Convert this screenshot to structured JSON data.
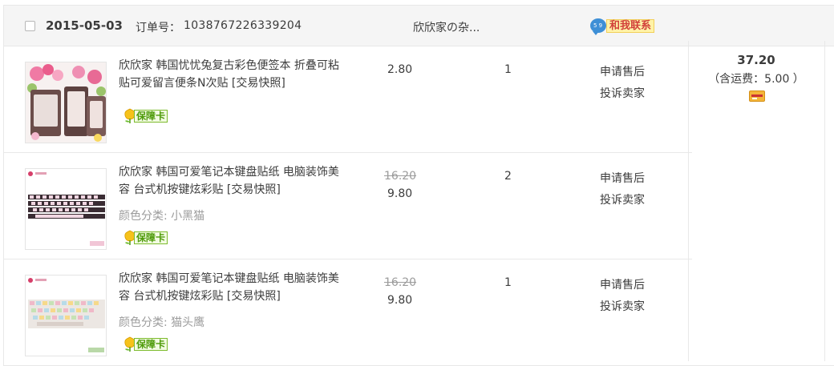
{
  "order": {
    "date": "2015-05-03",
    "order_no_label": "订单号：",
    "order_no": "1038767226339204",
    "shop_name": "欣欣家の杂...",
    "contact_label": "和我联系",
    "contact_badge": "5 9"
  },
  "items": [
    {
      "title": "欣欣家 韩国忧忧兔复古彩色便签本 折叠可粘贴可爱留言便条N次贴 [交易快照]",
      "sku_key": "",
      "sku_value": "",
      "guarantee": "保障卡",
      "price_original": "",
      "price": "2.80",
      "qty": "1",
      "actions": [
        "申请售后",
        "投诉卖家"
      ]
    },
    {
      "title": "欣欣家 韩国可爱笔记本键盘贴纸 电脑装饰美容 台式机按键炫彩贴 [交易快照]",
      "sku_key": "颜色分类: ",
      "sku_value": "小黑猫",
      "guarantee": "保障卡",
      "price_original": "16.20",
      "price": "9.80",
      "qty": "2",
      "actions": [
        "申请售后",
        "投诉卖家"
      ]
    },
    {
      "title": "欣欣家 韩国可爱笔记本键盘贴纸 电脑装饰美容 台式机按键炫彩贴 [交易快照]",
      "sku_key": "颜色分类: ",
      "sku_value": "猫头鹰",
      "guarantee": "保障卡",
      "price_original": "16.20",
      "price": "9.80",
      "qty": "1",
      "actions": [
        "申请售后",
        "投诉卖家"
      ]
    }
  ],
  "summary": {
    "total": "37.20",
    "shipping": "（含运费：5.00 ）"
  },
  "colors": {
    "header_bg": "#f5f5f5",
    "border": "#e8e8e8",
    "muted_text": "#9c9c9c",
    "guarantee_green": "#4e9b0a",
    "contact_red": "#d2403a"
  }
}
